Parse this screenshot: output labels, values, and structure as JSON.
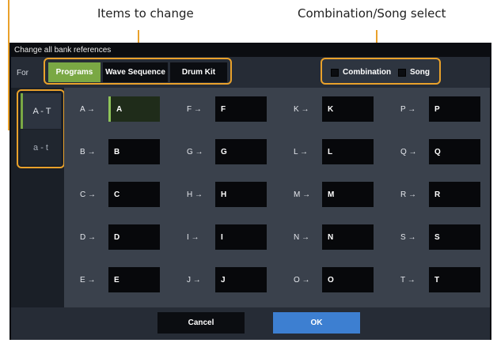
{
  "annotations": {
    "items_to_change": "Items to change",
    "combination_song_select": "Combination/Song select"
  },
  "dialog": {
    "title": "Change all bank references",
    "for_label": "For",
    "tabs": [
      {
        "label": "Programs",
        "selected": true
      },
      {
        "label": "Wave Sequence",
        "selected": false
      },
      {
        "label": "Drum Kit",
        "selected": false
      }
    ],
    "checkboxes": [
      {
        "label": "Combination",
        "checked": false
      },
      {
        "label": "Song",
        "checked": false
      }
    ],
    "range_tabs": [
      {
        "label": "A - T",
        "active": true
      },
      {
        "label": "a - t",
        "active": false
      }
    ],
    "bank_map": [
      {
        "label": "A →",
        "value": "A"
      },
      {
        "label": "B →",
        "value": "B"
      },
      {
        "label": "C →",
        "value": "C"
      },
      {
        "label": "D →",
        "value": "D"
      },
      {
        "label": "E →",
        "value": "E"
      },
      {
        "label": "F →",
        "value": "F"
      },
      {
        "label": "G →",
        "value": "G"
      },
      {
        "label": "H →",
        "value": "H"
      },
      {
        "label": "I →",
        "value": "I"
      },
      {
        "label": "J →",
        "value": "J"
      },
      {
        "label": "K →",
        "value": "K"
      },
      {
        "label": "L →",
        "value": "L"
      },
      {
        "label": "M →",
        "value": "M"
      },
      {
        "label": "N →",
        "value": "N"
      },
      {
        "label": "O →",
        "value": "O"
      },
      {
        "label": "P →",
        "value": "P"
      },
      {
        "label": "Q →",
        "value": "Q"
      },
      {
        "label": "R →",
        "value": "R"
      },
      {
        "label": "S →",
        "value": "S"
      },
      {
        "label": "T →",
        "value": "T"
      }
    ],
    "selected_bank": "A",
    "buttons": {
      "cancel": "Cancel",
      "ok": "OK"
    }
  },
  "colors": {
    "accent_annotation": "#e9a12b",
    "selected_green": "#7aa844",
    "ok_blue": "#3d7fd1"
  }
}
